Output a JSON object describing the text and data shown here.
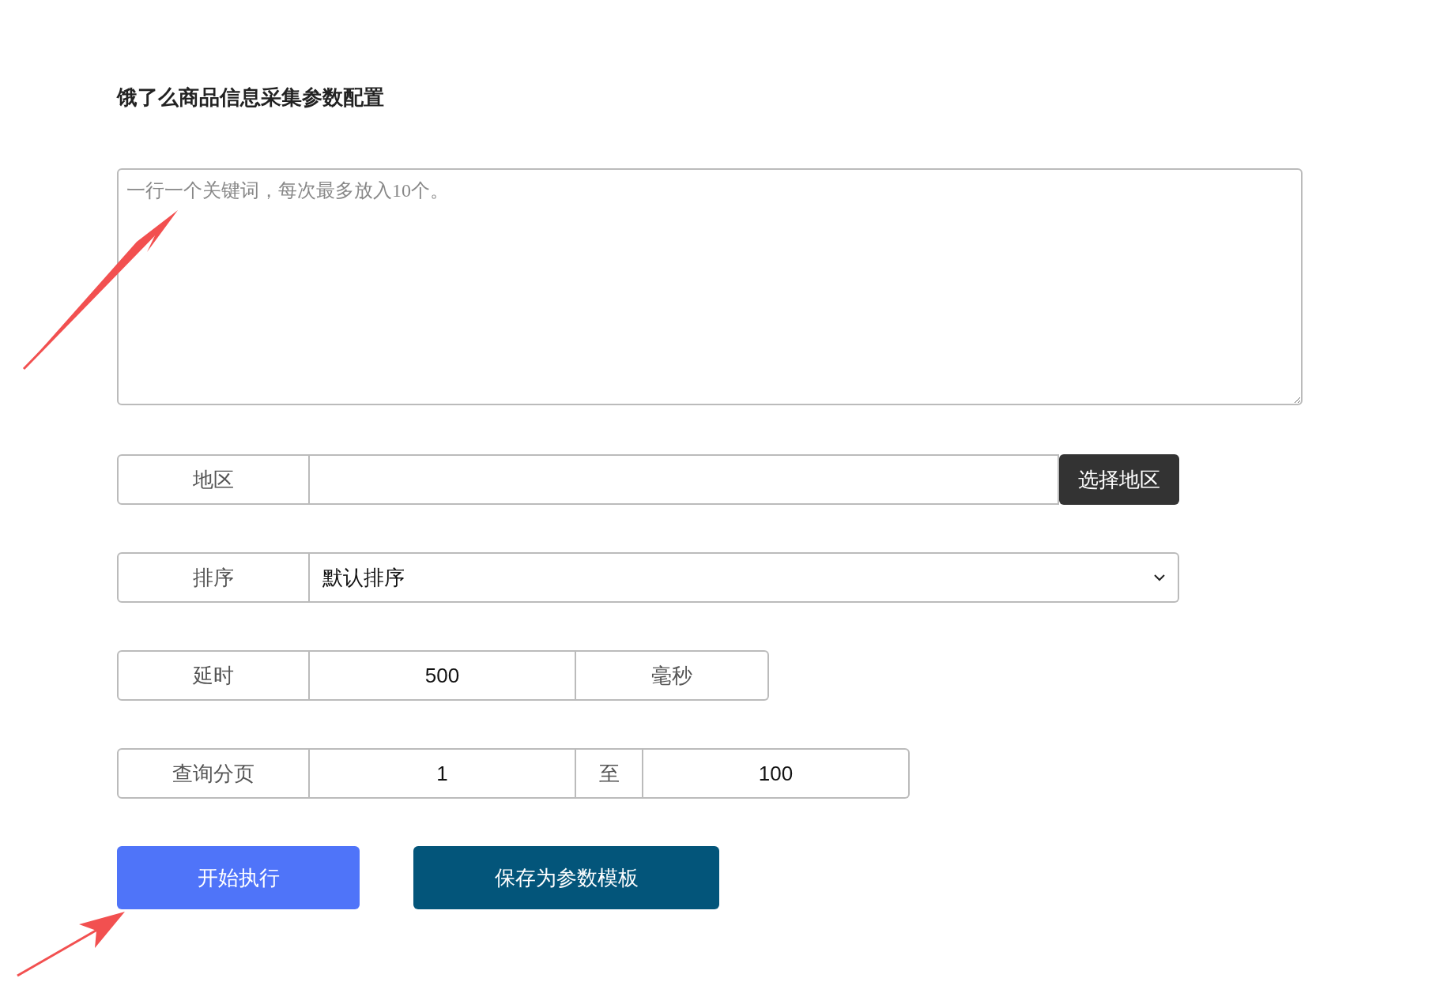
{
  "title": "饿了么商品信息采集参数配置",
  "keywords": {
    "placeholder": "一行一个关键词，每次最多放入10个。"
  },
  "region": {
    "label": "地区",
    "button": "选择地区"
  },
  "sort": {
    "label": "排序",
    "value": "默认排序"
  },
  "delay": {
    "label": "延时",
    "value": "500",
    "unit": "毫秒"
  },
  "pages": {
    "label": "查询分页",
    "from": "1",
    "separator": "至",
    "to": "100"
  },
  "buttons": [
    {
      "label": "开始执行",
      "kind": "primary"
    },
    {
      "label": "保存为参数模板",
      "kind": "secondary"
    }
  ]
}
